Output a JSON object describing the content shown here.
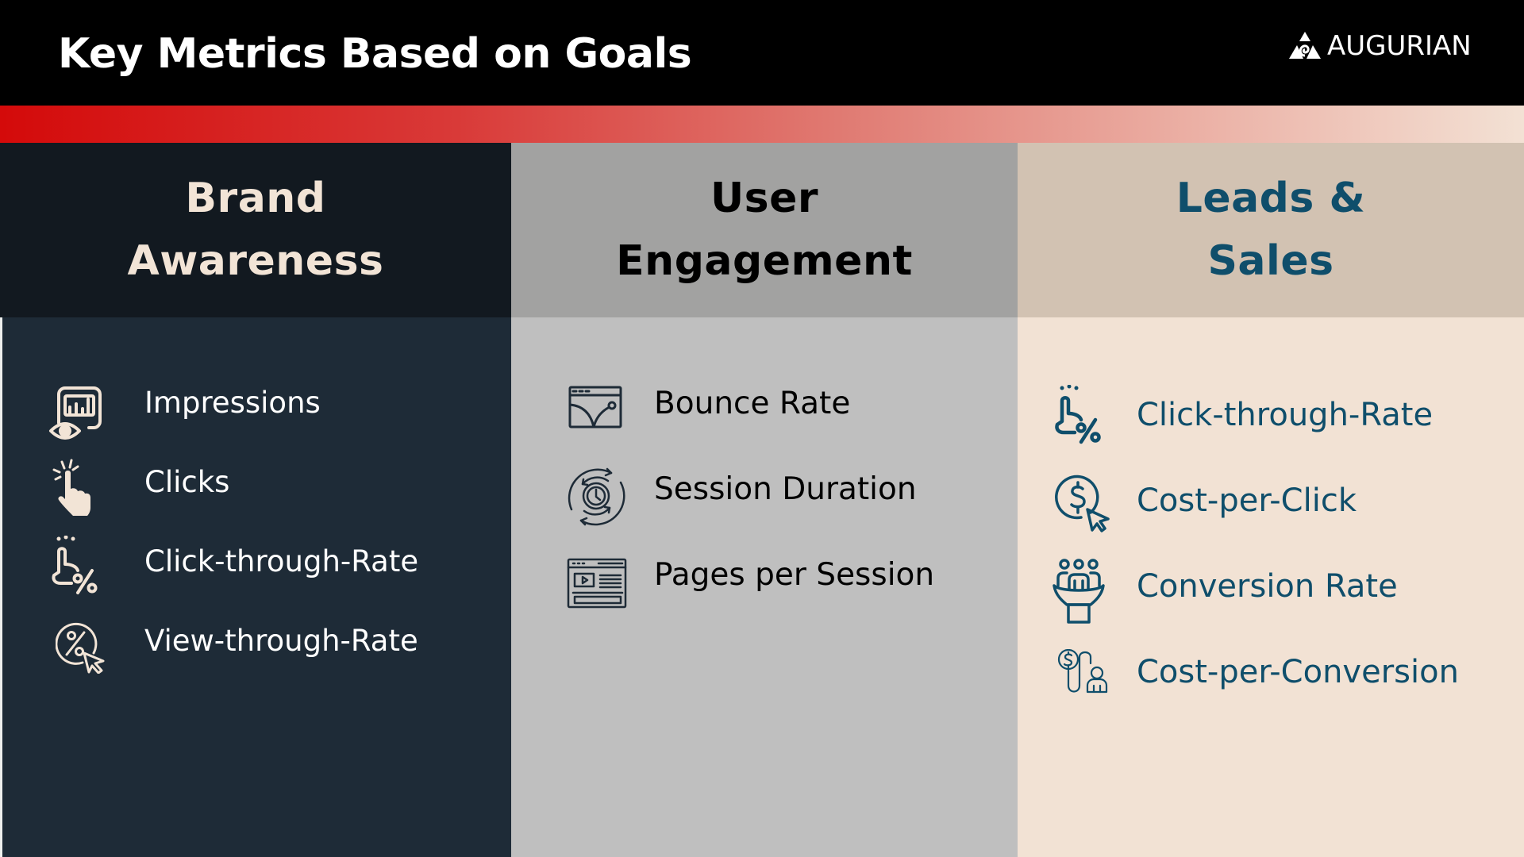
{
  "header": {
    "title": "Key Metrics Based on Goals",
    "logo": {
      "text": "AUGURIAN",
      "icon": "augurian-triangle-spiral-icon"
    }
  },
  "colors": {
    "header_bg": "#000000",
    "gradient_start": "#d40a0a",
    "gradient_end": "#f3e1d4",
    "brand_awareness_bg": "#1e2b37",
    "user_engagement_bg": "#bfbfbf",
    "leads_sales_bg": "#f2e2d4",
    "leads_sales_text": "#0f4e6b"
  },
  "columns": [
    {
      "heading_line1": "Brand",
      "heading_line2": "Awareness",
      "items": [
        {
          "label": "Impressions",
          "icon": "impressions-eye-chart-icon"
        },
        {
          "label": "Clicks",
          "icon": "pointer-hand-click-icon"
        },
        {
          "label": "Click-through-Rate",
          "icon": "hand-tap-percent-icon"
        },
        {
          "label": "View-through-Rate",
          "icon": "percent-circle-cursor-icon"
        }
      ]
    },
    {
      "heading_line1": "User",
      "heading_line2": "Engagement",
      "items": [
        {
          "label": "Bounce Rate",
          "icon": "browser-bounce-icon"
        },
        {
          "label": "Session Duration",
          "icon": "clock-cycle-icon"
        },
        {
          "label": "Pages per Session",
          "icon": "browser-page-video-icon"
        }
      ]
    },
    {
      "heading_line1": "Leads &",
      "heading_line2": "Sales",
      "items": [
        {
          "label": "Click-through-Rate",
          "icon": "hand-tap-percent-icon"
        },
        {
          "label": "Cost-per-Click",
          "icon": "dollar-circle-cursor-icon"
        },
        {
          "label": "Conversion Rate",
          "icon": "people-funnel-icon"
        },
        {
          "label": "Cost-per-Conversion",
          "icon": "dollar-to-person-icon"
        }
      ]
    }
  ]
}
